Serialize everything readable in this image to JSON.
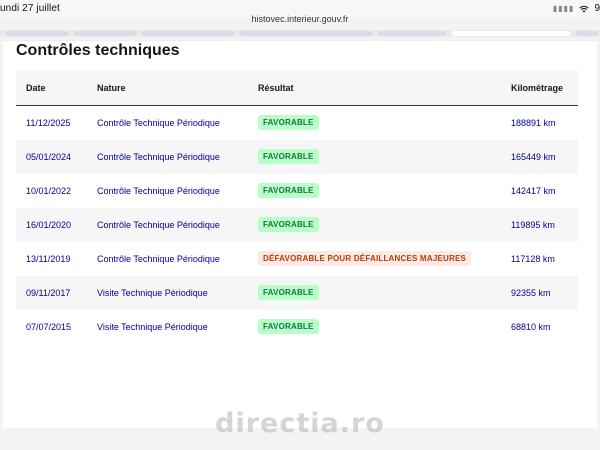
{
  "status_bar": {
    "time": "undi 27 juillet",
    "battery": "9"
  },
  "browser": {
    "url": "histovec.interieur.gouv.fr"
  },
  "page": {
    "title": "Contrôles techniques",
    "table": {
      "headers": [
        "Date",
        "Nature",
        "Résultat",
        "Kilométrage"
      ],
      "rows": [
        {
          "date": "11/12/2025",
          "nature": "Contrôle Technique Périodique",
          "result": "FAVORABLE",
          "result_type": "ok",
          "km": "188891 km"
        },
        {
          "date": "05/01/2024",
          "nature": "Contrôle Technique Périodique",
          "result": "FAVORABLE",
          "result_type": "ok",
          "km": "165449 km"
        },
        {
          "date": "10/01/2022",
          "nature": "Contrôle Technique Périodique",
          "result": "FAVORABLE",
          "result_type": "ok",
          "km": "142417 km"
        },
        {
          "date": "16/01/2020",
          "nature": "Contrôle Technique Périodique",
          "result": "FAVORABLE",
          "result_type": "ok",
          "km": "119895 km"
        },
        {
          "date": "13/11/2019",
          "nature": "Contrôle Technique Périodique",
          "result": "DÉFAVORABLE POUR DÉFAILLANCES MAJEURES",
          "result_type": "ko",
          "km": "117128 km"
        },
        {
          "date": "09/11/2017",
          "nature": "Visite Technique Périodique",
          "result": "FAVORABLE",
          "result_type": "ok",
          "km": "92355 km"
        },
        {
          "date": "07/07/2015",
          "nature": "Visite Technique Périodique",
          "result": "FAVORABLE",
          "result_type": "ok",
          "km": "68810 km"
        }
      ]
    }
  },
  "watermark": "directia.ro",
  "colors": {
    "link_blue": "#000091",
    "favorable_bg": "#b8fec9",
    "favorable_text": "#18753c",
    "defavorable_bg": "#ffe9e6",
    "defavorable_text": "#b34000"
  }
}
